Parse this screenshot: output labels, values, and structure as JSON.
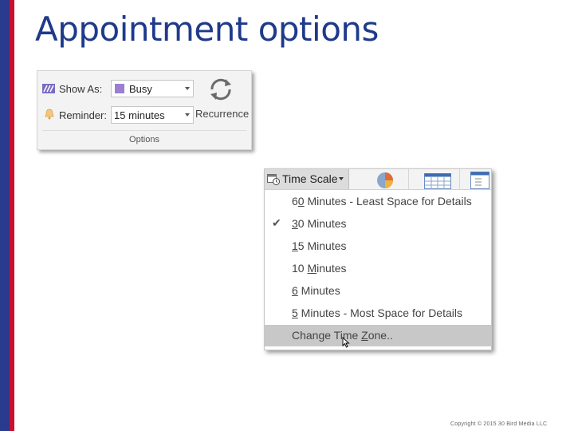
{
  "slide": {
    "title": "Appointment options",
    "copyright": "Copyright © 2015 30 Bird Media LLC"
  },
  "options_group": {
    "show_as_label": "Show As:",
    "show_as_value": "Busy",
    "reminder_label": "Reminder:",
    "reminder_value": "15 minutes",
    "recurrence_label": "Recurrence",
    "group_label": "Options",
    "busy_color": "#9b7fd1"
  },
  "time_scale": {
    "button_label": "Time Scale",
    "items": [
      {
        "accel": "0",
        "pre": "6",
        "post": " Minutes - Least Space for Details"
      },
      {
        "accel": "3",
        "pre": "",
        "post": "0 Minutes"
      },
      {
        "accel": "1",
        "pre": "",
        "post": "5 Minutes"
      },
      {
        "accel": "M",
        "pre": "10 ",
        "post": "inutes"
      },
      {
        "accel": "6",
        "pre": "",
        "post": " Minutes"
      },
      {
        "accel": "5",
        "pre": "",
        "post": " Minutes - Most Space for Details"
      }
    ],
    "change_tz": {
      "pre": "Change Time ",
      "accel": "Z",
      "post": "one.."
    }
  }
}
